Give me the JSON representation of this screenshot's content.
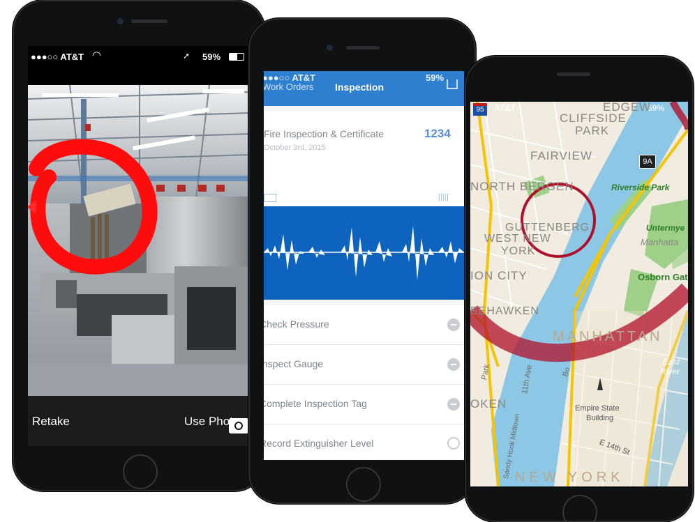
{
  "phone1": {
    "status": {
      "carrier": "●●●○○ AT&T",
      "battery": "59%"
    },
    "buttons": {
      "retake": "Retake",
      "use_photo": "Use Photo"
    }
  },
  "phone2": {
    "status": {
      "carrier": "●●●○○ AT&T",
      "battery": "59%"
    },
    "nav": {
      "back": "Work Orders",
      "title": "Inspection"
    },
    "work_order": {
      "title": "Fire Inspection & Certificate",
      "date": "October 3rd, 2015",
      "number": "1234"
    },
    "checklist": [
      {
        "label": "Check Pressure"
      },
      {
        "label": "Inspect Gauge"
      },
      {
        "label": "Complete Inspection Tag"
      },
      {
        "label": "Record Extinguisher Level"
      }
    ]
  },
  "phone3": {
    "status": {
      "carrier": "AT&T",
      "battery": "59%"
    },
    "map_labels": {
      "cliffside": "CLIFFSIDE",
      "park": "PARK",
      "edgewater": "EDGEW",
      "fairview": "FAIRVIEW",
      "north_bergen": "NORTH BERGEN",
      "guttenberg": "GUTTENBERG",
      "west_new_york_1": "WEST NEW",
      "west_new_york_2": "YORK",
      "union_city": "ION CITY",
      "weehawken": "EEHAWKEN",
      "manhattan": "MANHATTAN",
      "riverside_park": "Riverside Park",
      "untermyer": "Untermye",
      "manhattan_small": "Manhatta",
      "osborn": "Osborn Gat",
      "east_river_1": "East",
      "east_river_2": "River",
      "hoboken": "OKEN",
      "eleventh_ave": "11th Ave",
      "sandy_hook": "Sandy Hook Midtown",
      "empire_1": "Empire State",
      "empire_2": "Building",
      "e14th": "E 14th St",
      "new_york": "NEW YORK",
      "park_ave": "Park",
      "route": "9A",
      "interstate": "95",
      "road_bo": "Bo"
    }
  }
}
